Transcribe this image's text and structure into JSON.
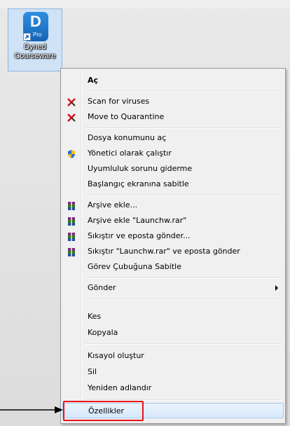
{
  "desktop": {
    "shortcut": {
      "tile_letter": "D",
      "tile_badge": "Pro",
      "label_line1": "Dyned",
      "label_line2": "Courseware"
    }
  },
  "context_menu": {
    "default_item": "Aç",
    "items": [
      {
        "label": "Scan for viruses",
        "icon": "kaspersky-icon"
      },
      {
        "label": "Move to Quarantine",
        "icon": "kaspersky-icon"
      },
      {
        "label": "Dosya konumunu aç"
      },
      {
        "label": "Yönetici olarak çalıştır",
        "icon": "uac-shield-icon"
      },
      {
        "label": "Uyumluluk sorunu giderme"
      },
      {
        "label": "Başlangıç ekranına sabitle"
      },
      {
        "label": "Arşive ekle...",
        "icon": "winrar-icon"
      },
      {
        "label": "Arşive ekle \"Launchw.rar\"",
        "icon": "winrar-icon"
      },
      {
        "label": "Sıkıştır ve eposta gönder...",
        "icon": "winrar-icon"
      },
      {
        "label": "Sıkıştır \"Launchw.rar\" ve eposta gönder",
        "icon": "winrar-icon"
      },
      {
        "label": "Görev Çubuğuna Sabitle"
      },
      {
        "label": "Gönder",
        "has_submenu": true
      },
      {
        "label": "Kes"
      },
      {
        "label": "Kopyala"
      },
      {
        "label": "Kısayol oluştur"
      },
      {
        "label": "Sil"
      },
      {
        "label": "Yeniden adlandır"
      },
      {
        "label": "Özellikler",
        "highlighted": true
      }
    ]
  },
  "annotation": {
    "highlight_color": "#e8141b",
    "arrow_color": "#000000"
  }
}
